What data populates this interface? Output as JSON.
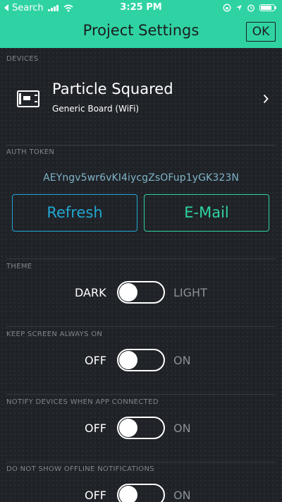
{
  "status_bar": {
    "back_app": "Search",
    "time": "3:25 PM",
    "battery_level": 0.85
  },
  "nav": {
    "title": "Project Settings",
    "ok_label": "OK"
  },
  "devices": {
    "section_label": "DEVICES",
    "device_name": "Particle Squared",
    "device_type": "Generic Board (WiFi)",
    "icon": "board-icon"
  },
  "auth": {
    "section_label": "AUTH TOKEN",
    "token": "AEYngv5wr6vKI4iycgZsOFup1yGK323N",
    "refresh_label": "Refresh",
    "email_label": "E-Mail"
  },
  "theme": {
    "section_label": "THEME",
    "left_label": "DARK",
    "right_label": "LIGHT",
    "selected": "DARK"
  },
  "keep_screen_on": {
    "section_label": "KEEP SCREEN ALWAYS ON",
    "left_label": "OFF",
    "right_label": "ON",
    "selected": "OFF"
  },
  "notify_devices": {
    "section_label": "NOTIFY DEVICES WHEN APP CONNECTED",
    "left_label": "OFF",
    "right_label": "ON",
    "selected": "OFF"
  },
  "offline_notifications": {
    "section_label": "DO NOT SHOW OFFLINE NOTIFICATIONS",
    "left_label": "OFF",
    "right_label": "ON",
    "selected": "OFF"
  },
  "colors": {
    "accent_green": "#2fd3a3",
    "accent_blue": "#22a7d1",
    "background": "#1f2227",
    "token_text": "#7fb4c8"
  }
}
